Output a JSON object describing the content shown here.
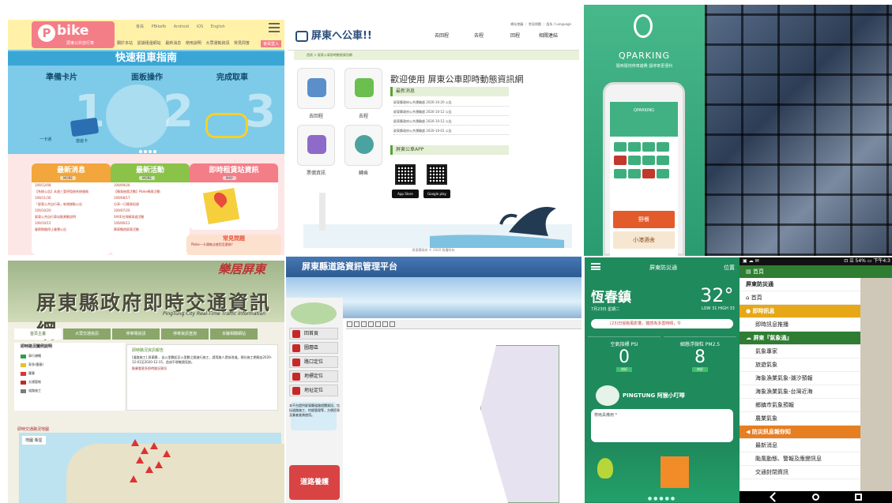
{
  "pbike": {
    "brand": "bike",
    "brand_sub": "屏東公共自行車",
    "top_links": [
      "會員",
      "PBikefb",
      "Android",
      "iOS",
      "English"
    ],
    "nav": [
      "關於本站",
      "認識租還網站",
      "最新消息",
      "使用說明",
      "大眾運輸資訊",
      "常見問答"
    ],
    "lang_button": "會員登入",
    "hero_title": "快速租車指南",
    "steps": [
      "準備卡片",
      "面板操作",
      "完成取車"
    ],
    "step_numbers": [
      "1",
      "2",
      "3"
    ],
    "card_labels": [
      "一卡通",
      "悠遊卡"
    ],
    "boxes": [
      {
        "title": "最新消息",
        "more": "MORE",
        "lines": [
          "109/12/08",
          "【系統公告】本週三暫停租借系統服務",
          "109/11/30",
          "「屏東公共自行車」新增據點公告",
          "109/10/20",
          "屏東公共自行車站點異動說明",
          "109/10/15",
          "春節期間停止營運公告"
        ]
      },
      {
        "title": "最新活動",
        "more": "MORE",
        "lines": [
          "109/09/26",
          "【騎乘抽獎活動】Pbike騎乘活動",
          "109/08/17",
          "分享一日騎乘紀錄",
          "109/07/20",
          "SAVE台灣騎乘週活動",
          "109/06/12",
          "單車暢遊屏東活動"
        ]
      },
      {
        "title": "即時租賃站資訊",
        "more": "MAP",
        "lines": []
      }
    ],
    "faq": {
      "title": "常見問題",
      "more": "MORE",
      "line": "Pbike一卡通無法使用怎麼辦？"
    }
  },
  "bus": {
    "brand": "屏東へ公車!!",
    "top_links": "網站地圖 ｜ 常見問題 ｜ 語系 / Language",
    "menu": [
      "去回程",
      "去程",
      "回程",
      "相關連結"
    ],
    "breadcrumb": "首頁 > 屏東公車即時動態資訊網",
    "tiles": [
      "去回程",
      "去程",
      "票價資訊",
      "轉乘"
    ],
    "welcome": "歡迎使用 屏東公車即時動態資訊網",
    "section_news": "最新消息",
    "news": [
      "屏東縣政府公共運輸處 2020-10-20 公告",
      "屏東縣政府公共運輸處 2020-10-12 公告",
      "屏東縣政府公共運輸處 2020-10-12 公告",
      "屏東縣政府公共運輸處 2020-10-01 公告"
    ],
    "section_app": "屏東公車APP",
    "stores": [
      "App Store",
      "Google play"
    ],
    "footer": "屏東縣政府 © 2020 版權所有"
  },
  "qparking": {
    "title": "QPARKING",
    "subtitle": "隨時隨地停車繳費 讓停車更便利",
    "phone_header": "QPARKING",
    "ads": [
      "野餐",
      "小港酒舍"
    ]
  },
  "traffic": {
    "title": "屏東縣政府即時交通資訊網",
    "title_en": "PingTung City Real-Time Traffic Information",
    "corner": "樂居屏東",
    "tabs": [
      "首頁主畫",
      "大眾交通資訊",
      "停車場資訊",
      "停車資訊查詢",
      "本縣相關網站"
    ],
    "legend_title": "即時路況圖例說明",
    "legend": [
      {
        "label": "車行順暢",
        "color": "#2e9e44"
      },
      {
        "label": "車多(壅塞)",
        "color": "#e6c127"
      },
      {
        "label": "壅塞",
        "color": "#d33"
      },
      {
        "label": "交通管制",
        "color": "#c62828"
      },
      {
        "label": "道路施工",
        "color": "#7b7b7b"
      }
    ],
    "notice_title": "即時路況資訊報告",
    "notice_body": "[道路施工] 屏東縣... 自公里數起至公里數之間進行施工，請用路人提前改道。預計施工期間自2020-12-01至2020-12-15，造成不便敬請見諒。",
    "notice_link": "點擊看更多即時路況資訊",
    "map_title": "即時交通路況地圖",
    "map_tabs": "地圖  衛星",
    "warnings": 8
  },
  "road": {
    "title": "屏東縣道路資訊管理平台",
    "side_buttons": [
      "回首頁",
      "圖層區",
      "路口定位",
      "地標定位",
      "地址定位"
    ],
    "info": "本平台提供屏東縣道路相關資訊，包括道路施工、挖掘管理等，方便民眾及業者查詢使用。",
    "road_button": "道路養護"
  },
  "disaster": {
    "menu_title": "屏東防災通",
    "location_label": "位置",
    "town": "恆春鎮",
    "date": "7月23日 星期二",
    "temp": "32°",
    "hilo": "LOW 31 HIGH 33",
    "alert": "(23)日受颱風影響，體感為多雲時晴，午",
    "aqi_label": "空氣指標 PSI",
    "aqi": "0",
    "aqi_status": "良好",
    "pm_label": "細懸浮微粒 PM2.5",
    "pm": "8",
    "pm_status": "良好",
    "monkey": "PINGTUNG 阿猴小叮嚀",
    "bubble": "帶雨具備用 *",
    "pager": "●●●●●"
  },
  "menu_app": {
    "status_left": "▣ ☁ ✉",
    "status_right": "⊡ ☰ 54% ▭ 下午4:3",
    "home": "首頁",
    "items": [
      {
        "label": "屏東防災通",
        "type": "title"
      },
      {
        "label": "首頁",
        "type": "home"
      },
      {
        "label": "即時訊息",
        "type": "sec"
      },
      {
        "label": "即時訊息推播",
        "type": "item"
      },
      {
        "label": "屏東『氣象通』",
        "type": "sec2"
      },
      {
        "label": "氣象專家",
        "type": "item"
      },
      {
        "label": "旅遊氣象",
        "type": "item"
      },
      {
        "label": "海象漁業氣象-潮汐預報",
        "type": "item"
      },
      {
        "label": "海象漁業氣象-台灣近海",
        "type": "item"
      },
      {
        "label": "鄉鎮市氣象預報",
        "type": "item"
      },
      {
        "label": "農業氣象",
        "type": "item"
      },
      {
        "label": "防災訊息報你知",
        "type": "sec3"
      },
      {
        "label": "最新消息",
        "type": "item"
      },
      {
        "label": "颱風動態、警報及應變訊息",
        "type": "item"
      },
      {
        "label": "交通封閉資訊",
        "type": "item"
      }
    ]
  }
}
